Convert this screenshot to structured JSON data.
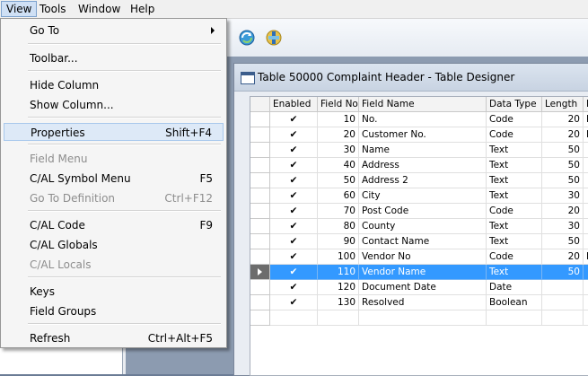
{
  "menubar": {
    "items": [
      {
        "label": "View"
      },
      {
        "label": "Tools"
      },
      {
        "label": "Window"
      },
      {
        "label": "Help"
      }
    ]
  },
  "view_menu": {
    "items": [
      {
        "label": "Go To",
        "shortcut": "",
        "disabled": false
      },
      {
        "label": "Toolbar...",
        "shortcut": "",
        "disabled": false
      },
      {
        "label": "Hide Column",
        "shortcut": "",
        "disabled": false
      },
      {
        "label": "Show Column...",
        "shortcut": "",
        "disabled": false
      },
      {
        "label": "Properties",
        "shortcut": "Shift+F4",
        "disabled": false
      },
      {
        "label": "Field Menu",
        "shortcut": "",
        "disabled": true
      },
      {
        "label": "C/AL Symbol Menu",
        "shortcut": "F5",
        "disabled": false
      },
      {
        "label": "Go To Definition",
        "shortcut": "Ctrl+F12",
        "disabled": true
      },
      {
        "label": "C/AL Code",
        "shortcut": "F9",
        "disabled": false
      },
      {
        "label": "C/AL Globals",
        "shortcut": "",
        "disabled": false
      },
      {
        "label": "C/AL Locals",
        "shortcut": "",
        "disabled": true
      },
      {
        "label": "Keys",
        "shortcut": "",
        "disabled": false
      },
      {
        "label": "Field Groups",
        "shortcut": "",
        "disabled": false
      },
      {
        "label": "Refresh",
        "shortcut": "Ctrl+Alt+F5",
        "disabled": false
      }
    ]
  },
  "designer": {
    "title": "Table 50000 Complaint Header - Table Designer",
    "columns": [
      "Enabled",
      "Field No.",
      "Field Name",
      "Data Type",
      "Length",
      "D"
    ],
    "rows": [
      {
        "enabled": "✔",
        "field_no": "10",
        "field_name": "No.",
        "data_type": "Code",
        "length": "20",
        "desc": "D"
      },
      {
        "enabled": "✔",
        "field_no": "20",
        "field_name": "Customer No.",
        "data_type": "Code",
        "length": "20",
        "desc": "L"
      },
      {
        "enabled": "✔",
        "field_no": "30",
        "field_name": "Name",
        "data_type": "Text",
        "length": "50",
        "desc": ""
      },
      {
        "enabled": "✔",
        "field_no": "40",
        "field_name": "Address",
        "data_type": "Text",
        "length": "50",
        "desc": ""
      },
      {
        "enabled": "✔",
        "field_no": "50",
        "field_name": "Address 2",
        "data_type": "Text",
        "length": "50",
        "desc": ""
      },
      {
        "enabled": "✔",
        "field_no": "60",
        "field_name": "City",
        "data_type": "Text",
        "length": "30",
        "desc": ""
      },
      {
        "enabled": "✔",
        "field_no": "70",
        "field_name": "Post Code",
        "data_type": "Code",
        "length": "20",
        "desc": ""
      },
      {
        "enabled": "✔",
        "field_no": "80",
        "field_name": "County",
        "data_type": "Text",
        "length": "30",
        "desc": ""
      },
      {
        "enabled": "✔",
        "field_no": "90",
        "field_name": "Contact Name",
        "data_type": "Text",
        "length": "50",
        "desc": ""
      },
      {
        "enabled": "✔",
        "field_no": "100",
        "field_name": "Vendor No",
        "data_type": "Code",
        "length": "20",
        "desc": "L"
      },
      {
        "enabled": "✔",
        "field_no": "110",
        "field_name": "Vendor Name",
        "data_type": "Text",
        "length": "50",
        "desc": ""
      },
      {
        "enabled": "✔",
        "field_no": "120",
        "field_name": "Document Date",
        "data_type": "Date",
        "length": "",
        "desc": ""
      },
      {
        "enabled": "✔",
        "field_no": "130",
        "field_name": "Resolved",
        "data_type": "Boolean",
        "length": "",
        "desc": ""
      },
      {
        "enabled": "",
        "field_no": "",
        "field_name": "",
        "data_type": "",
        "length": "",
        "desc": ""
      }
    ],
    "selected_row": 10
  },
  "toolbar": {
    "icons": [
      "refresh-icon",
      "tools-icon"
    ]
  }
}
